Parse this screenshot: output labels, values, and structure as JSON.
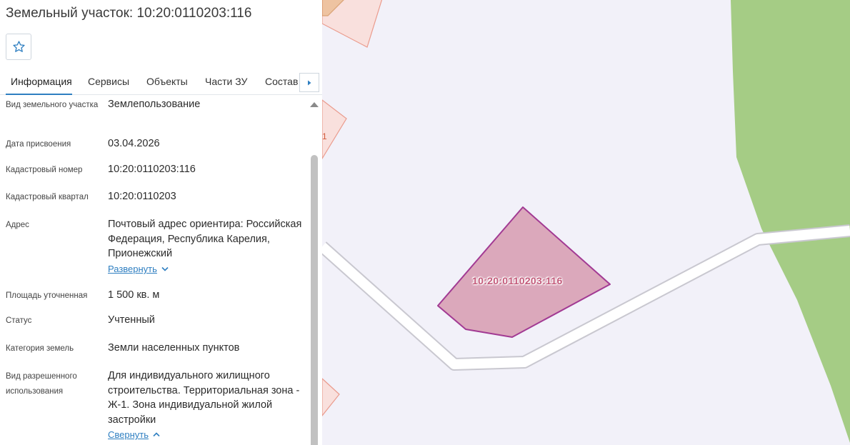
{
  "panel": {
    "title": "Земельный участок: 10:20:0110203:116",
    "favorite_icon": "star-outline-icon",
    "tabs": [
      {
        "label": "Информация",
        "active": true
      },
      {
        "label": "Сервисы",
        "active": false
      },
      {
        "label": "Объекты",
        "active": false
      },
      {
        "label": "Части ЗУ",
        "active": false
      },
      {
        "label": "Состав",
        "active": false
      }
    ],
    "tabs_next_icon": "caret-right-icon",
    "rows": [
      {
        "label": "Вид земельного участка",
        "value": "Землепользование"
      },
      {
        "label": "Дата присвоения",
        "value": "03.04.2026"
      },
      {
        "label": "Кадастровый номер",
        "value": "10:20:0110203:116"
      },
      {
        "label": "Кадастровый квартал",
        "value": "10:20:0110203"
      },
      {
        "label": "Адрес",
        "value": "Почтовый адрес ориентира: Российская Федерация, Республика Карелия, Прионежский",
        "link": "Развернуть"
      },
      {
        "label": "Площадь уточненная",
        "value": "1 500 кв. м"
      },
      {
        "label": "Статус",
        "value": "Учтенный"
      },
      {
        "label": "Категория земель",
        "value": "Земли населенных пунктов"
      },
      {
        "label": "Вид разрешенного использования",
        "value": "Для индивидуального жилищного строительства. Территориальная зона - Ж-1. Зона индивидуальной жилой застройки",
        "link": "Свернуть"
      }
    ]
  },
  "map": {
    "parcel_label": "10:20:0110203:116",
    "edge_label": "1",
    "colors": {
      "background": "#f2f1f9",
      "forest": "#a5cc85",
      "parcel_fill": "#dba8bb",
      "parcel_stroke": "#a23a93",
      "neighbor_fill": "#f9e0dd",
      "neighbor_stroke": "#ea9b8d",
      "road": "#ffffff"
    }
  },
  "accent_color": "#2f7fc1"
}
